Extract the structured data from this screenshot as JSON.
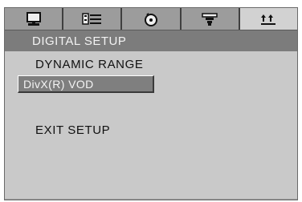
{
  "tabs": [
    {
      "icon": "monitor-icon",
      "active": false
    },
    {
      "icon": "audio-language-icon",
      "active": false
    },
    {
      "icon": "disc-icon",
      "active": false
    },
    {
      "icon": "speaker-icon",
      "active": false
    },
    {
      "icon": "digital-icon",
      "active": true
    }
  ],
  "header": {
    "title": "DIGITAL SETUP"
  },
  "menu": {
    "dynamic_range": "DYNAMIC RANGE",
    "divx_vod": "DivX(R) VOD",
    "exit_setup": "EXIT SETUP"
  }
}
